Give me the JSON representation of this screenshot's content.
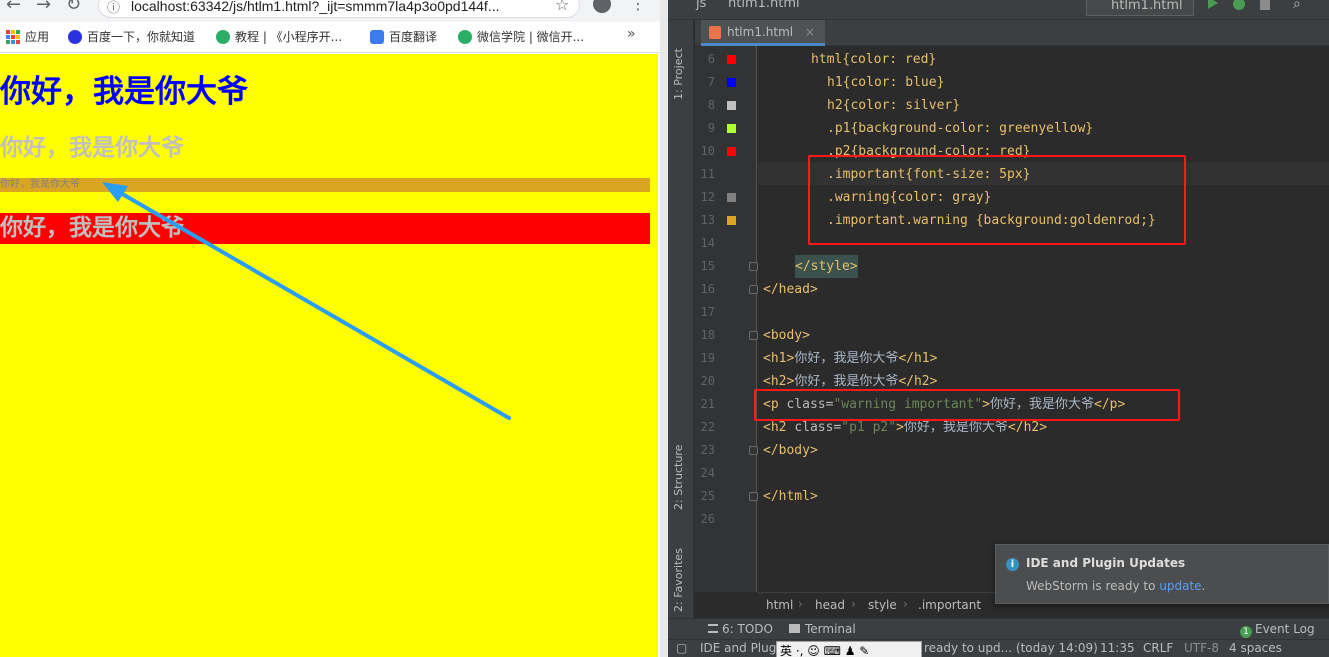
{
  "browser": {
    "url": "localhost:63342/js/htlm1.html?_ijt=smmm7la4p3o0pd144f...",
    "bookmarks": [
      {
        "label": "应用",
        "icon": "apps-grid-icon"
      },
      {
        "label": "百度一下，你就知道",
        "icon": "baidu-paw-icon"
      },
      {
        "label": "教程 | 《小程序开...",
        "icon": "wechat-icon"
      },
      {
        "label": "百度翻译",
        "icon": "translate-icon"
      },
      {
        "label": "微信学院 | 微信开...",
        "icon": "wechat-icon"
      }
    ],
    "more": "»",
    "page": {
      "h1": "你好，我是你大爷",
      "h2": "你好，我是你大爷",
      "p": "你好，我是你大爷",
      "h2b": "你好，我是你大爷"
    },
    "colors": {
      "h1": "#0000ff",
      "h2": "#c0c0c0",
      "p_bg": "#daa520",
      "h2b_bg": "#ff0000",
      "page_bg": "#ffff00"
    }
  },
  "ide": {
    "top_js": "js",
    "top_file": "htlm1.html",
    "run_config": "htlm1.html",
    "file_tab": "htlm1.html",
    "side_tabs": [
      "1: Project",
      "2: Structure",
      "2: Favorites"
    ],
    "line_numbers": [
      "6",
      "7",
      "8",
      "9",
      "10",
      "11",
      "12",
      "13",
      "14",
      "15",
      "16",
      "17",
      "18",
      "19",
      "20",
      "21",
      "22",
      "23",
      "24",
      "25",
      "26"
    ],
    "swatch_colors": [
      "#ff0000",
      "#0000ff",
      "#c0c0c0",
      "#adff2f",
      "#ff0000",
      "",
      "#808080",
      "#daa520"
    ],
    "code": {
      "l6": "html{color: red}",
      "l7": "h1{color: blue}",
      "l8": "h2{color: silver}",
      "l9": ".p1{background-color: greenyellow}",
      "l10": ".p2{background-color: red}",
      "l11": ".important{font-size: 5px}",
      "l12": ".warning{color: gray}",
      "l13": ".important.warning {background:goldenrod;}",
      "l15": "</style>",
      "l16": "</head>",
      "l18": "<body>",
      "l19_tag_open": "<h1>",
      "l19_text": "你好，我是你大爷",
      "l19_tag_close": "</h1>",
      "l20_tag_open": "<h2>",
      "l20_text": "你好，我是你大爷",
      "l20_tag_close": "</h2>",
      "l21_open": "<p ",
      "l21_attr": "class=",
      "l21_val": "\"warning important\"",
      "l21_gt": ">",
      "l21_text": "你好，我是你大爷",
      "l21_close": "</p>",
      "l22_open": "<h2 ",
      "l22_attr": "class=",
      "l22_val": "\"p1 p2\"",
      "l22_gt": ">",
      "l22_text": "你好，我是你大爷",
      "l22_close": "</h2>",
      "l23": "</body>",
      "l25": "</html>"
    },
    "breadcrumbs": [
      "html",
      "head",
      "style",
      ".important"
    ],
    "tool_windows": {
      "todo": "6: TODO",
      "terminal": "Terminal",
      "event_log": "Event Log",
      "event_count": "1"
    },
    "status": {
      "left": "IDE and Plug",
      "ime": "英 ·, ☺ ⌨ ♟ ✎",
      "message": "ready to upd... (today 14:09)",
      "position": "11:35",
      "line_sep": "CRLF",
      "encoding": "UTF-8",
      "indent": "4 spaces"
    },
    "notification": {
      "title": "IDE and Plugin Updates",
      "body_prefix": "WebStorm is ready to ",
      "link": "update",
      "body_suffix": "."
    }
  }
}
